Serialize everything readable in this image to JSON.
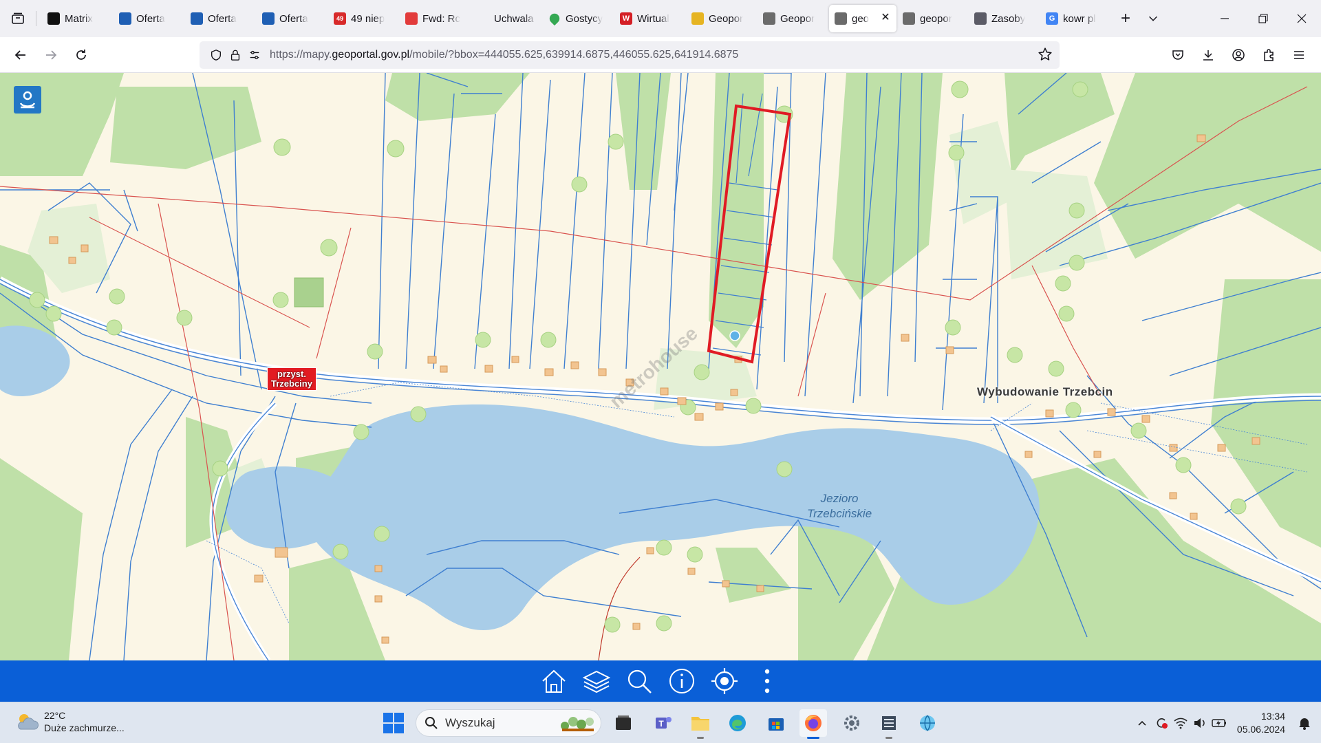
{
  "browser": {
    "tabs": [
      {
        "title": "Matrix",
        "favicon": "matrix-icon",
        "favicon_color": "#111111"
      },
      {
        "title": "Oferta",
        "favicon": "oferta-icon",
        "favicon_color": "#1f5fb4"
      },
      {
        "title": "Oferta",
        "favicon": "oferta-icon",
        "favicon_color": "#1f5fb4"
      },
      {
        "title": "Oferta",
        "favicon": "oferta-icon",
        "favicon_color": "#1f5fb4"
      },
      {
        "title": "49 niep",
        "favicon": "mail-counter-icon",
        "favicon_color": "#d82a2a",
        "badge": "49"
      },
      {
        "title": "Fwd: Rc",
        "favicon": "mail-icon",
        "favicon_color": "#e23b3b"
      },
      {
        "title": "Uchwala Nr",
        "favicon": "none",
        "favicon_color": "#f0f0f4"
      },
      {
        "title": "Gostycy",
        "favicon": "maps-pin-icon",
        "favicon_color": "#34a853"
      },
      {
        "title": "Wirtual",
        "favicon": "wp-icon",
        "favicon_color": "#d41f26",
        "badge": "W"
      },
      {
        "title": "Geopor",
        "favicon": "geoportal-flag-icon",
        "favicon_color": "#e6b422"
      },
      {
        "title": "Geopor",
        "favicon": "geoportal-icon",
        "favicon_color": "#6b6b6b"
      },
      {
        "title": "geo",
        "favicon": "geoportal-icon",
        "favicon_color": "#6b6b6b",
        "active": true
      },
      {
        "title": "geopor",
        "favicon": "geoportal-icon",
        "favicon_color": "#6b6b6b"
      },
      {
        "title": "Zasoby",
        "favicon": "loading-icon",
        "favicon_color": "#5b5b66"
      },
      {
        "title": "kowr pl",
        "favicon": "google-icon",
        "favicon_color": "#4285f4",
        "badge": "G"
      }
    ],
    "url_prefix": "https://mapy.",
    "url_domain": "geoportal.gov.pl",
    "url_rest": "/mobile/?bbox=444055.625,639914.6875,446055.625,641914.6875"
  },
  "map": {
    "stop_label_line1": "przyst.",
    "stop_label_line2": "Trzebciny",
    "village_label": "Wybudowanie Trzebcin",
    "lake_label_line1": "Jezioro",
    "lake_label_line2": "Trzebcińskie",
    "watermark": "metrohouse",
    "colors": {
      "land": "#fbf6e6",
      "forest": "#bfe0a8",
      "meadow": "#e4f0d6",
      "water": "#a9cde8",
      "parcel_border": "#3f7fd0",
      "highlight": "#e01b24",
      "toolbar": "#0a5fd7"
    }
  },
  "taskbar": {
    "weather_temp": "22°C",
    "weather_desc": "Duże zachmurze...",
    "search_placeholder": "Wyszukaj",
    "time": "13:34",
    "date": "05.06.2024"
  }
}
